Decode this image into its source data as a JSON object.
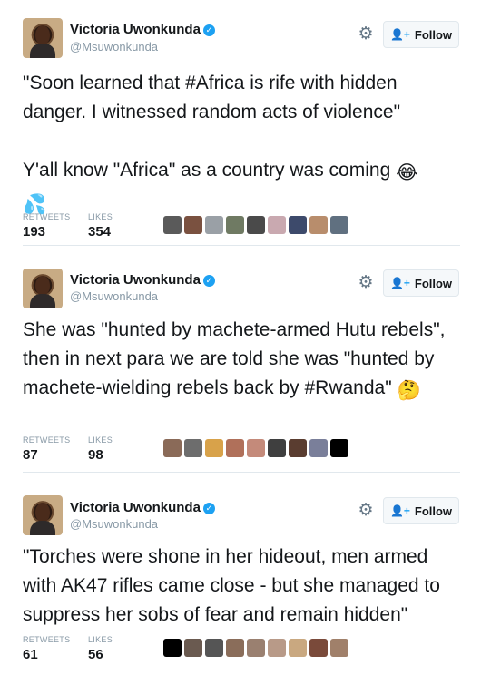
{
  "tweets": [
    {
      "name": "Victoria Uwonkunda",
      "handle": "@Msuwonkunda",
      "follow_label": "Follow",
      "text_line1": "\"Soon learned that #Africa is rife with hidden danger. I witnessed random acts of violence\"",
      "text_line2": "Y'all know \"Africa\" as a country was coming",
      "emoji_1": "😂",
      "emoji_2": "💦",
      "retweets_label": "RETWEETS",
      "retweets": "193",
      "likes_label": "LIKES",
      "likes": "354",
      "liker_colors": [
        "#5a5a5a",
        "#7a5140",
        "#9aa0a6",
        "#6f7a63",
        "#4a4a4a",
        "#c9a9b0",
        "#3d4a6b",
        "#b88d6c",
        "#607080"
      ]
    },
    {
      "name": "Victoria Uwonkunda",
      "handle": "@Msuwonkunda",
      "follow_label": "Follow",
      "text": "She was \"hunted by machete-armed Hutu rebels\", then in next para we are told she was \"hunted by machete-wielding rebels back by #Rwanda\"",
      "emoji_1": "🤔",
      "retweets_label": "RETWEETS",
      "retweets": "87",
      "likes_label": "LIKES",
      "likes": "98",
      "liker_colors": [
        "#8a6a58",
        "#6d6d6d",
        "#d8a24a",
        "#b0705a",
        "#c48a7a",
        "#3f3f3f",
        "#5a3d30",
        "#7a7f9a",
        "#000000"
      ]
    },
    {
      "name": "Victoria Uwonkunda",
      "handle": "@Msuwonkunda",
      "follow_label": "Follow",
      "text": "\"Torches were shone in her hideout, men armed with AK47 rifles came close - but she managed to suppress her sobs of fear and remain hidden\"",
      "retweets_label": "RETWEETS",
      "retweets": "61",
      "likes_label": "LIKES",
      "likes": "56",
      "liker_colors": [
        "#000000",
        "#6a5a50",
        "#555555",
        "#8a6d5a",
        "#9a8070",
        "#b89a88",
        "#c9a880",
        "#7a4a3a",
        "#a0806a"
      ]
    }
  ],
  "icons": {
    "gear": "gear-icon",
    "verified": "verified-badge-icon",
    "follow": "add-person-icon"
  },
  "colors": {
    "accent": "#1da1f2",
    "muted": "#8899a6",
    "text": "#14171a",
    "divider": "#e1e8ed"
  }
}
